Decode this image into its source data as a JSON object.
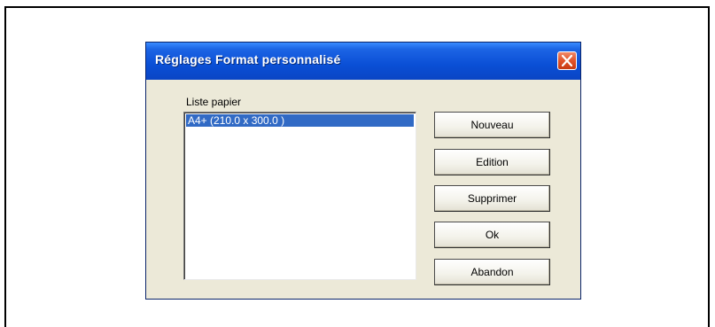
{
  "dialog": {
    "title": "Réglages Format personnalisé",
    "list_label": "Liste papier",
    "list_items": [
      "A4+ (210.0 x 300.0 )"
    ],
    "buttons": {
      "new": "Nouveau",
      "edit": "Edition",
      "delete": "Supprimer",
      "ok": "Ok",
      "cancel": "Abandon"
    },
    "icons": {
      "close": "close-icon"
    },
    "colors": {
      "titlebar": "#0a4fd6",
      "selection": "#316ac5",
      "face": "#ece9d8",
      "close": "#e0532a"
    }
  }
}
